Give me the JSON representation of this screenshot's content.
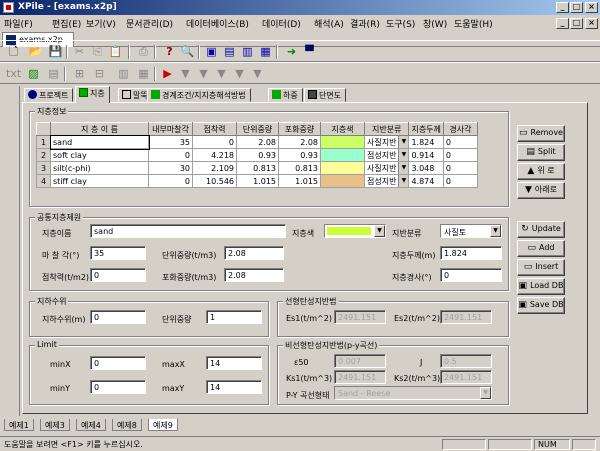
{
  "window": {
    "title": "XPile - [exams.x2p]",
    "controls": [
      "_",
      "□",
      "×"
    ]
  },
  "menu": [
    "파일(F)",
    "편집(E)",
    "보기(V)",
    "문서관리(D)",
    "데이터베이스(B)",
    "데이터(D)",
    "해석(A)",
    "결과(R)",
    "도구(S)",
    "창(W)",
    "도움말(H)"
  ],
  "doc_tab": "exams.x2p",
  "panel_tabs": [
    {
      "label": "프로젝트",
      "icon": "info-icon",
      "color": "#000080"
    },
    {
      "label": "지층",
      "icon": "layers-icon",
      "color": "#008000"
    },
    {
      "label": "말뚝",
      "icon": "pile-icon",
      "color": "#000000"
    },
    {
      "label": "경계조건/지지층해석방법",
      "icon": "boundary-icon",
      "color": "#008000"
    },
    {
      "label": "하중",
      "icon": "load-icon",
      "color": "#008000"
    },
    {
      "label": "단면도",
      "icon": "section-icon",
      "color": "#000000"
    }
  ],
  "strata": {
    "caption": "지층정보",
    "columns": [
      "지 층 이 름",
      "내부마찰각",
      "점착력",
      "단위중량",
      "포화중량",
      "지층색",
      "지반분류",
      "지층두께",
      "경사각"
    ],
    "rows": [
      {
        "no": "1",
        "name": "sand",
        "phi": "35",
        "c": "0",
        "gamma": "2.08",
        "gsat": "2.08",
        "color": "#ccff66",
        "class": "사질지반",
        "thick": "1.824",
        "incl": "0"
      },
      {
        "no": "2",
        "name": "soft clay",
        "phi": "0",
        "c": "4.218",
        "gamma": "0.93",
        "gsat": "0.93",
        "color": "#99ffcc",
        "class": "점성지반",
        "thick": "0.914",
        "incl": "0"
      },
      {
        "no": "3",
        "name": "silt(c-phi)",
        "phi": "30",
        "c": "2.109",
        "gamma": "0.813",
        "gsat": "0.813",
        "color": "#ffff99",
        "class": "사질지반",
        "thick": "3.048",
        "incl": "0"
      },
      {
        "no": "4",
        "name": "stiff clay",
        "phi": "0",
        "c": "10.546",
        "gamma": "1.015",
        "gsat": "1.015",
        "color": "#e8c08a",
        "class": "점성지반",
        "thick": "4.874",
        "incl": "0"
      }
    ]
  },
  "side_buttons": [
    {
      "label": "Remove",
      "icon": "remove-icon",
      "glyph": "▭"
    },
    {
      "label": "Split",
      "icon": "split-icon",
      "glyph": "▤"
    },
    {
      "label": "위 로",
      "icon": "arrow-up-icon",
      "glyph": "▲"
    },
    {
      "label": "아래로",
      "icon": "arrow-down-icon",
      "glyph": "▼"
    }
  ],
  "side_buttons2": [
    {
      "label": "Update",
      "icon": "update-icon",
      "glyph": "↻"
    },
    {
      "label": "Add",
      "icon": "add-icon",
      "glyph": "▭"
    },
    {
      "label": "Insert",
      "icon": "insert-icon",
      "glyph": "▭"
    },
    {
      "label": "Load DB",
      "icon": "load-db-icon",
      "glyph": "▣"
    },
    {
      "label": "Save DB",
      "icon": "save-db-icon",
      "glyph": "▣"
    }
  ],
  "common": {
    "caption": "공통지층제원",
    "name_label": "지층이름",
    "name_value": "sand",
    "color_label": "지층색",
    "color_value": "#ccff33",
    "class_label": "지반분류",
    "class_value": "사질토",
    "phi_label": "마 찰 각(°)",
    "phi_value": "35",
    "gamma_label": "단위중량(t/m3)",
    "gamma_value": "2.08",
    "thick_label": "지층두께(m)",
    "thick_value": "1.824",
    "c_label": "점착력(t/m2)",
    "c_value": "0",
    "gsat_label": "포화중량(t/m3)",
    "gsat_value": "2.08",
    "incl_label": "지층경사(°)",
    "incl_value": "0"
  },
  "water": {
    "caption": "지하수위",
    "level_label": "지하수위(m)",
    "level_value": "0",
    "unit_label": "단위중량",
    "unit_value": "1"
  },
  "linear": {
    "caption": "선형탄성지반법",
    "es1_label": "Es1(t/m^2)",
    "es1_value": "2491.151",
    "es2_label": "Es2(t/m^2)",
    "es2_value": "2491.151"
  },
  "limit": {
    "caption": "Limit",
    "minx_label": "minX",
    "minx_value": "0",
    "maxx_label": "maxX",
    "maxx_value": "14",
    "miny_label": "minY",
    "miny_value": "0",
    "maxy_label": "maxY",
    "maxy_value": "14"
  },
  "nonlinear": {
    "caption": "비선형탄성지반법(p-y곡선)",
    "e50_label": "ε50",
    "e50_value": "0.007",
    "j_label": "J",
    "j_value": "0.5",
    "ks1_label": "Ks1(t/m^3)",
    "ks1_value": "2491.151",
    "ks2_label": "Ks2(t/m^3)",
    "ks2_value": "2491.151",
    "curve_label": "P-Y 곡선형태",
    "curve_value": "Sand    - Reese"
  },
  "bottom_tabs": [
    "예제1",
    "예제3",
    "예제4",
    "예제8",
    "예제9"
  ],
  "status": {
    "text": "도움말을 보려면 <F1> 키를 누르십시오.",
    "num": "NUM"
  }
}
